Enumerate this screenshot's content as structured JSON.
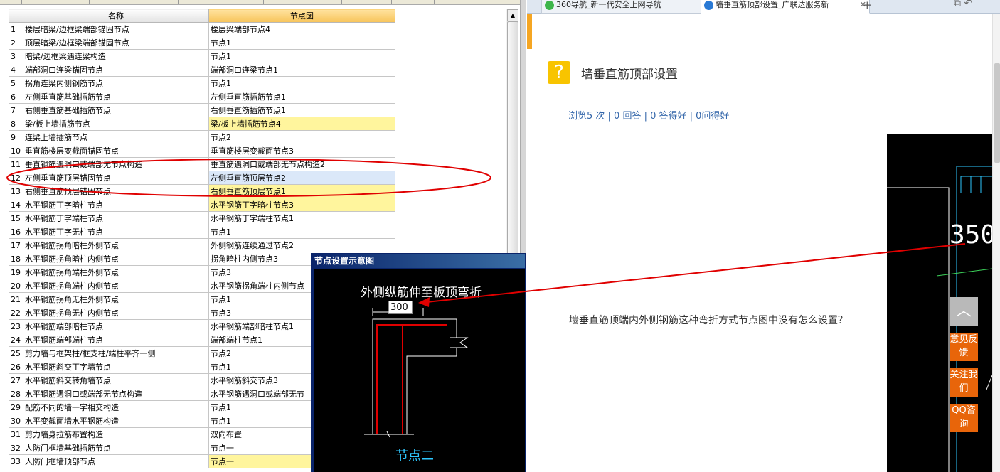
{
  "table": {
    "headers": [
      "名称",
      "节点图"
    ],
    "rows": [
      {
        "num": "1",
        "name": "楼层暗梁/边框梁端部锚固节点",
        "node": "楼层梁端部节点4",
        "hl": false
      },
      {
        "num": "2",
        "name": "顶层暗梁/边框梁端部锚固节点",
        "node": "节点1",
        "hl": false
      },
      {
        "num": "3",
        "name": "暗梁/边框梁遇连梁构造",
        "node": "节点1",
        "hl": false
      },
      {
        "num": "4",
        "name": "端部洞口连梁锚固节点",
        "node": "端部洞口连梁节点1",
        "hl": false
      },
      {
        "num": "5",
        "name": "拐角连梁内侧钢筋节点",
        "node": "节点1",
        "hl": false
      },
      {
        "num": "6",
        "name": "左侧垂直筋基础插筋节点",
        "node": "左侧垂直筋插筋节点1",
        "hl": false
      },
      {
        "num": "7",
        "name": "右侧垂直筋基础插筋节点",
        "node": "右侧垂直筋插筋节点1",
        "hl": false
      },
      {
        "num": "8",
        "name": "梁/板上墙插筋节点",
        "node": "梁/板上墙插筋节点4",
        "hl": true
      },
      {
        "num": "9",
        "name": "连梁上墙插筋节点",
        "node": "节点2",
        "hl": false
      },
      {
        "num": "10",
        "name": "垂直筋楼层变截面锚固节点",
        "node": "垂直筋楼层变截面节点3",
        "hl": false
      },
      {
        "num": "11",
        "name": "垂直钢筋遇洞口或端部无节点构造",
        "node": "垂直筋遇洞口或端部无节点构造2",
        "hl": false
      },
      {
        "num": "12",
        "name": "左侧垂直筋顶层锚固节点",
        "node": "左侧垂直筋顶层节点2",
        "hl": false,
        "selected": true
      },
      {
        "num": "13",
        "name": "右侧垂直筋顶层锚固节点",
        "node": "右侧垂直筋顶层节点1",
        "hl": true
      },
      {
        "num": "14",
        "name": "水平钢筋丁字暗柱节点",
        "node": "水平钢筋丁字暗柱节点3",
        "hl": true
      },
      {
        "num": "15",
        "name": "水平钢筋丁字端柱节点",
        "node": "水平钢筋丁字端柱节点1",
        "hl": false
      },
      {
        "num": "16",
        "name": "水平钢筋丁字无柱节点",
        "node": "节点1",
        "hl": false
      },
      {
        "num": "17",
        "name": "水平钢筋拐角暗柱外侧节点",
        "node": "外侧钢筋连续通过节点2",
        "hl": false
      },
      {
        "num": "18",
        "name": "水平钢筋拐角暗柱内侧节点",
        "node": "拐角暗柱内侧节点3",
        "hl": false
      },
      {
        "num": "19",
        "name": "水平钢筋拐角端柱外侧节点",
        "node": "节点3",
        "hl": false
      },
      {
        "num": "20",
        "name": "水平钢筋拐角端柱内侧节点",
        "node": "水平钢筋拐角端柱内侧节点",
        "hl": false
      },
      {
        "num": "21",
        "name": "水平钢筋拐角无柱外侧节点",
        "node": "节点1",
        "hl": false
      },
      {
        "num": "22",
        "name": "水平钢筋拐角无柱内侧节点",
        "node": "节点3",
        "hl": false
      },
      {
        "num": "23",
        "name": "水平钢筋端部暗柱节点",
        "node": "水平钢筋端部暗柱节点1",
        "hl": false
      },
      {
        "num": "24",
        "name": "水平钢筋端部端柱节点",
        "node": "端部端柱节点1",
        "hl": false
      },
      {
        "num": "25",
        "name": "剪力墙与框架柱/框支柱/端柱平齐一侧",
        "node": "节点2",
        "hl": false
      },
      {
        "num": "26",
        "name": "水平钢筋斜交丁字墙节点",
        "node": "节点1",
        "hl": false
      },
      {
        "num": "27",
        "name": "水平钢筋斜交转角墙节点",
        "node": "水平钢筋斜交节点3",
        "hl": false
      },
      {
        "num": "28",
        "name": "水平钢筋遇洞口或端部无节点构造",
        "node": "水平钢筋遇洞口或端部无节",
        "hl": false
      },
      {
        "num": "29",
        "name": "配筋不同的墙一字相交构造",
        "node": "节点1",
        "hl": false
      },
      {
        "num": "30",
        "name": "水平变截面墙水平钢筋构造",
        "node": "节点1",
        "hl": false
      },
      {
        "num": "31",
        "name": "剪力墙身拉筋布置构造",
        "node": "双向布置",
        "hl": false
      },
      {
        "num": "32",
        "name": "人防门框墙基础插筋节点",
        "node": "节点一",
        "hl": false
      },
      {
        "num": "33",
        "name": "人防门框墙顶部节点",
        "node": "节点一",
        "hl": true
      }
    ]
  },
  "dialog": {
    "title": "节点设置示意图",
    "heading": "外侧纵筋伸至板顶弯折",
    "input_value": "300",
    "node_label": "节点二"
  },
  "browser": {
    "tabs": [
      {
        "label": "360导航_新一代安全上网导航",
        "active": false
      },
      {
        "label": "墙垂直筋顶部设置_广联达服务新",
        "active": true
      }
    ],
    "new_tab": "+",
    "question": {
      "title": "墙垂直筋顶部设置",
      "stats": "浏览5 次 | 0 回答 | 0 答得好 | 0问得好",
      "body": "墙垂直筋顶端内外侧钢筋这种弯折方式节点图中没有怎么设置？",
      "cad_text": "350"
    },
    "side": {
      "feedback": "意见反馈",
      "follow": "关注我们",
      "qq": "QQ咨询"
    }
  },
  "colors": {
    "highlight": "#fff59d",
    "header_selected": "#f7c45a",
    "annotation": "#e00000",
    "side_button": "#e8650a"
  }
}
